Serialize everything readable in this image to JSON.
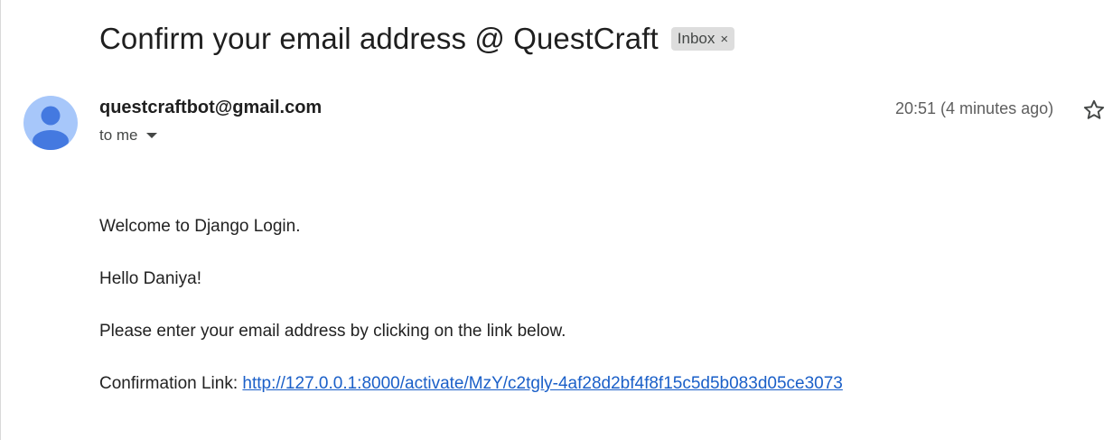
{
  "email": {
    "subject": "Confirm your email address @ QuestCraft",
    "label": {
      "text": "Inbox",
      "close_glyph": "×"
    },
    "sender": "questcraftbot@gmail.com",
    "recipient": "to me",
    "timestamp": "20:51 (4 minutes ago)",
    "body": {
      "greeting": "Welcome to Django Login.",
      "salutation": "Hello Daniya!",
      "instruction": "Please enter your email address by clicking on the link below.",
      "link_prefix": "Confirmation Link: ",
      "link_text": "http://127.0.0.1:8000/activate/MzY/c2tgly-4af28d2bf4f8f15c5d5b083d05ce3073"
    }
  },
  "icons": {
    "avatar": "person-avatar-icon",
    "recipient_details": "caret-down-icon",
    "star": "star-outline-icon",
    "label_remove": "close-icon"
  },
  "colors": {
    "avatar_bg": "#a7c7fa",
    "avatar_figure": "#4479e0",
    "link": "#1a5fc8",
    "chip_bg": "#dddddd"
  }
}
